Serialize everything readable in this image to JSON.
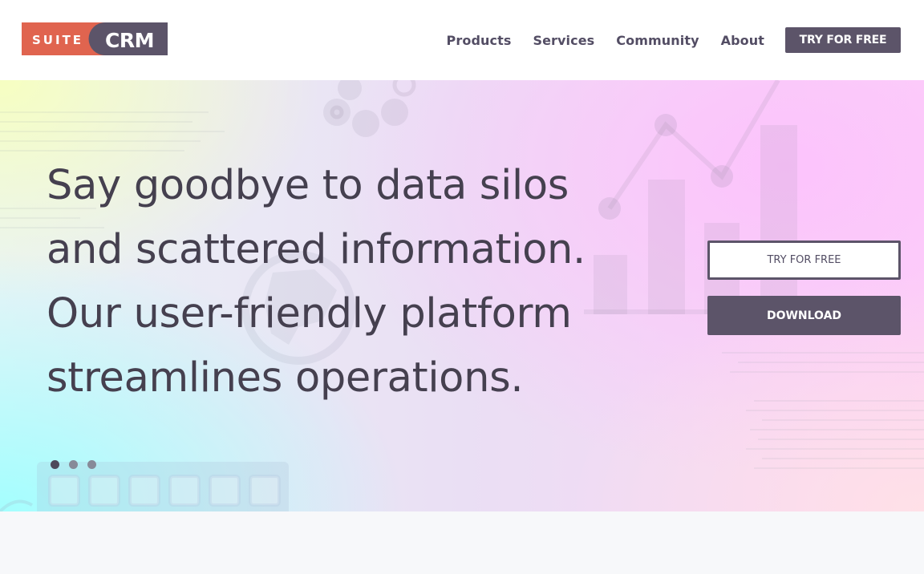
{
  "header": {
    "logo": {
      "part1": "SUITE",
      "part2": "CRM"
    },
    "nav": [
      {
        "label": "Products"
      },
      {
        "label": "Services"
      },
      {
        "label": "Community"
      },
      {
        "label": "About"
      }
    ],
    "cta_label": "TRY FOR FREE"
  },
  "hero": {
    "headline_lines": [
      "Say goodbye to data silos",
      "and scattered information.",
      "Our user-friendly platform",
      "streamlines operations."
    ],
    "try_button": "TRY FOR FREE",
    "download_button": "DOWNLOAD",
    "carousel": {
      "total": 3,
      "active": 1
    }
  },
  "colors": {
    "brand_red": "#e0644f",
    "brand_purple": "#5c5469",
    "text_dark": "#45404f"
  },
  "icons": [
    "suitecrm-logo",
    "carousel-dot"
  ]
}
